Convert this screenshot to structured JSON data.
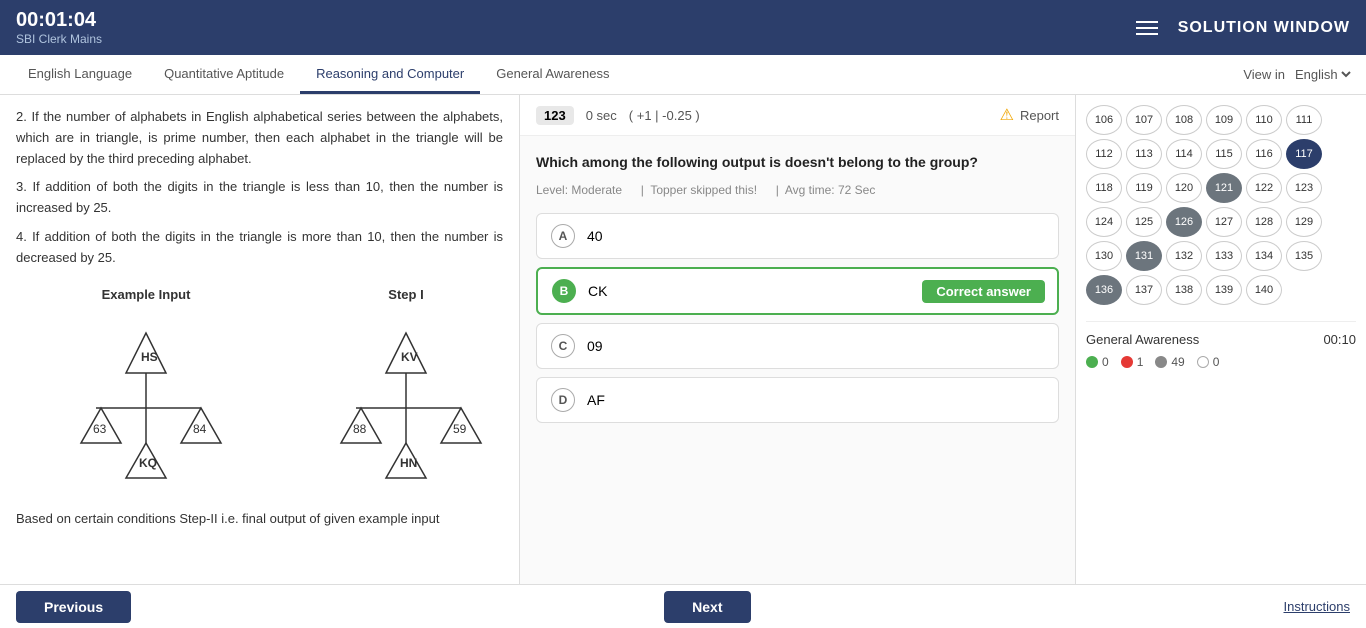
{
  "header": {
    "timer": "00:01:04",
    "exam_name": "SBI Clerk Mains",
    "menu_icon": "hamburger-icon",
    "solution_title": "SOLUTION WINDOW"
  },
  "nav": {
    "tabs": [
      {
        "id": "english",
        "label": "English Language",
        "active": false
      },
      {
        "id": "quant",
        "label": "Quantitative Aptitude",
        "active": false
      },
      {
        "id": "reasoning",
        "label": "Reasoning and Computer",
        "active": true
      },
      {
        "id": "awareness",
        "label": "General Awareness",
        "active": false
      }
    ],
    "view_in_label": "View in",
    "language": "English"
  },
  "left_panel": {
    "text_lines": [
      "2. If the number of alphabets in English alphabetical series between the alphabets, which are in triangle, is prime number, then each alphabet in the triangle will be replaced by the third preceding alphabet.",
      "3. If addition of both the digits in the triangle is less than 10, then the number is increased by 25.",
      "4. If addition of both the digits in the triangle is more than 10, then the number is decreased by 25."
    ],
    "example_label": "Example Input",
    "step_label": "Step I",
    "bottom_text": "Based on certain conditions Step-II i.e. final output of given example input"
  },
  "question": {
    "number": "123",
    "time": "0 sec",
    "marks_plus": "+1",
    "marks_minus": "-0.25",
    "report_label": "Report",
    "text": "Which among the following output is doesn't belong to the group?",
    "level": "Moderate",
    "topper": "Topper skipped this!",
    "avg_time": "Avg time: 72 Sec",
    "options": [
      {
        "id": "A",
        "text": "40",
        "selected": false,
        "correct": false
      },
      {
        "id": "B",
        "text": "CK",
        "selected": true,
        "correct": true
      },
      {
        "id": "C",
        "text": "09",
        "selected": false,
        "correct": false
      },
      {
        "id": "D",
        "text": "AF",
        "selected": false,
        "correct": false
      }
    ],
    "correct_badge": "Correct answer"
  },
  "right_panel": {
    "numbers": [
      {
        "n": "106",
        "state": "default"
      },
      {
        "n": "107",
        "state": "default"
      },
      {
        "n": "108",
        "state": "default"
      },
      {
        "n": "109",
        "state": "default"
      },
      {
        "n": "110",
        "state": "default"
      },
      {
        "n": "111",
        "state": "default"
      },
      {
        "n": "112",
        "state": "default"
      },
      {
        "n": "113",
        "state": "default"
      },
      {
        "n": "114",
        "state": "default"
      },
      {
        "n": "115",
        "state": "default"
      },
      {
        "n": "116",
        "state": "default"
      },
      {
        "n": "117",
        "state": "active"
      },
      {
        "n": "118",
        "state": "default"
      },
      {
        "n": "119",
        "state": "default"
      },
      {
        "n": "120",
        "state": "default"
      },
      {
        "n": "121",
        "state": "attempted"
      },
      {
        "n": "122",
        "state": "default"
      },
      {
        "n": "123",
        "state": "default"
      },
      {
        "n": "124",
        "state": "default"
      },
      {
        "n": "125",
        "state": "default"
      },
      {
        "n": "126",
        "state": "attempted"
      },
      {
        "n": "127",
        "state": "default"
      },
      {
        "n": "128",
        "state": "default"
      },
      {
        "n": "129",
        "state": "default"
      },
      {
        "n": "130",
        "state": "default"
      },
      {
        "n": "131",
        "state": "attempted"
      },
      {
        "n": "132",
        "state": "default"
      },
      {
        "n": "133",
        "state": "default"
      },
      {
        "n": "134",
        "state": "default"
      },
      {
        "n": "135",
        "state": "default"
      },
      {
        "n": "136",
        "state": "attempted"
      },
      {
        "n": "137",
        "state": "default"
      },
      {
        "n": "138",
        "state": "default"
      },
      {
        "n": "139",
        "state": "default"
      },
      {
        "n": "140",
        "state": "default"
      }
    ],
    "subject": "General Awareness",
    "subject_time": "00:10",
    "legend": [
      {
        "color": "#4caf50",
        "count": "0"
      },
      {
        "color": "#e53935",
        "count": "1"
      },
      {
        "color": "#888888",
        "count": "49"
      },
      {
        "color": "white",
        "count": "0"
      }
    ]
  },
  "footer": {
    "previous_label": "Previous",
    "next_label": "Next",
    "instructions_label": "Instructions"
  }
}
